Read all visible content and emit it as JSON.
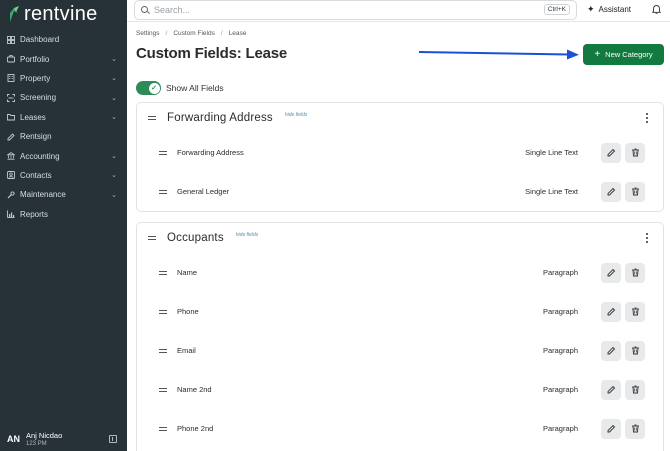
{
  "app": {
    "brand": "rentvine",
    "brand_color": "#2e8b57",
    "accent_color": "#137a3f"
  },
  "sidebar": {
    "items": [
      {
        "label": "Dashboard",
        "icon": "dashboard-icon",
        "chevron": false
      },
      {
        "label": "Portfolio",
        "icon": "briefcase-icon",
        "chevron": true
      },
      {
        "label": "Property",
        "icon": "building-icon",
        "chevron": true
      },
      {
        "label": "Screening",
        "icon": "screening-icon",
        "chevron": true
      },
      {
        "label": "Leases",
        "icon": "folder-icon",
        "chevron": true
      },
      {
        "label": "Rentsign",
        "icon": "rentsign-icon",
        "chevron": false
      },
      {
        "label": "Accounting",
        "icon": "bank-icon",
        "chevron": true
      },
      {
        "label": "Contacts",
        "icon": "contacts-icon",
        "chevron": true
      },
      {
        "label": "Maintenance",
        "icon": "wrench-icon",
        "chevron": true
      },
      {
        "label": "Reports",
        "icon": "chart-icon",
        "chevron": false
      }
    ],
    "user": {
      "initials": "AN",
      "name": "Anj Nicdao",
      "subtitle": "123 PM"
    }
  },
  "topbar": {
    "search_placeholder": "Search...",
    "search_shortcut": "Ctrl+K",
    "assistant_label": "Assistant"
  },
  "page": {
    "breadcrumb": [
      "Settings",
      "Custom Fields",
      "Lease"
    ],
    "title": "Custom Fields: Lease",
    "new_category_label": "New Category",
    "show_all_label": "Show All Fields",
    "show_all_on": true
  },
  "categories": [
    {
      "title": "Forwarding Address",
      "hide_label": "hide fields",
      "fields": [
        {
          "name": "Forwarding Address",
          "type": "Single Line Text"
        },
        {
          "name": "General Ledger",
          "type": "Single Line Text"
        }
      ]
    },
    {
      "title": "Occupants",
      "hide_label": "hide fields",
      "fields": [
        {
          "name": "Name",
          "type": "Paragraph"
        },
        {
          "name": "Phone",
          "type": "Paragraph"
        },
        {
          "name": "Email",
          "type": "Paragraph"
        },
        {
          "name": "Name 2nd",
          "type": "Paragraph"
        },
        {
          "name": "Phone 2nd",
          "type": "Paragraph"
        }
      ]
    }
  ]
}
